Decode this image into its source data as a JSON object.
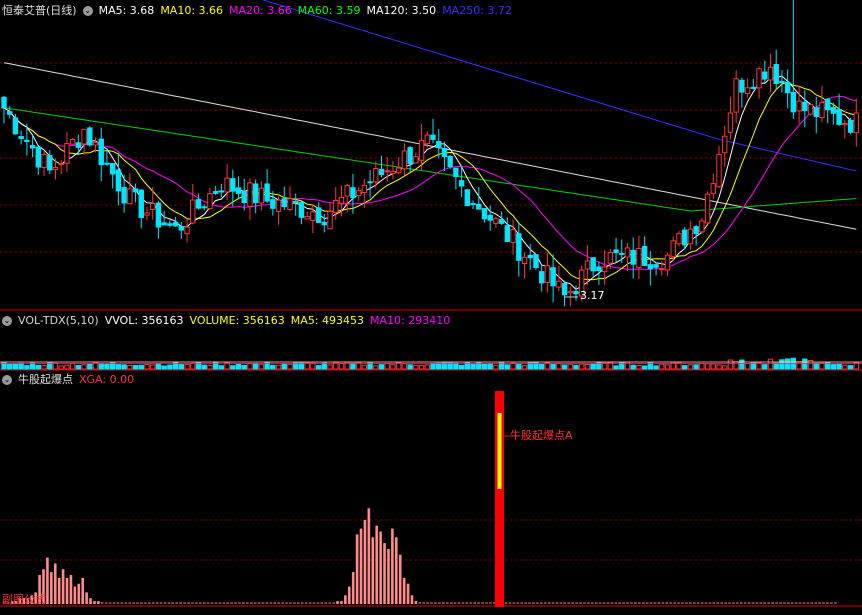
{
  "main_header": {
    "stock": "恒泰艾普",
    "period": "(日线)",
    "ma_items": [
      {
        "label": "MA5: 3.68",
        "color": "#ffffff"
      },
      {
        "label": "MA10: 3.66",
        "color": "#ffff00"
      },
      {
        "label": "MA20: 3.66",
        "color": "#ff00ff"
      },
      {
        "label": "MA60: 3.59",
        "color": "#00ff00"
      },
      {
        "label": "MA120: 3.50",
        "color": "#ffffff"
      },
      {
        "label": "MA250: 3.72",
        "color": "#3333ff"
      }
    ]
  },
  "low_marker": "3.17",
  "vol_header": {
    "items": [
      {
        "label": "VOL-TDX(5,10)",
        "color": "#d8d8d8"
      },
      {
        "label": "VVOL: 356163",
        "color": "#ffffff"
      },
      {
        "label": "VOLUME: 356163",
        "color": "#ffff00"
      },
      {
        "label": "MA5: 493453",
        "color": "#ffff00"
      },
      {
        "label": "MA10: 293410",
        "color": "#ff00ff"
      }
    ]
  },
  "ind_header": {
    "name": "牛股起爆点",
    "xga": "XGA: 0.00"
  },
  "signal_label": "牛股起爆点A",
  "corner_label": "副图公式",
  "colors": {
    "up": "#ff3333",
    "down": "#00e5ff",
    "grid": "#8b0000",
    "sep": "#b00000",
    "bar": "#ff8a8a",
    "signal": "#ff0000",
    "signal_core": "#ffff00"
  },
  "chart_data": [
    {
      "type": "candlestick",
      "title": "恒泰艾普 (日线)",
      "series": [
        {
          "name": "MA5",
          "values": [
            3.68
          ]
        },
        {
          "name": "MA10",
          "values": [
            3.66
          ]
        },
        {
          "name": "MA20",
          "values": [
            3.66
          ]
        },
        {
          "name": "MA60",
          "values": [
            3.59
          ]
        },
        {
          "name": "MA120",
          "values": [
            3.5
          ]
        },
        {
          "name": "MA250",
          "values": [
            3.72
          ]
        }
      ],
      "annotations": [
        {
          "label": "3.17",
          "value": 3.17
        }
      ]
    },
    {
      "type": "bar",
      "title": "VOL-TDX(5,10)",
      "series": [
        {
          "name": "VVOL",
          "values": [
            356163
          ]
        },
        {
          "name": "VOLUME",
          "values": [
            356163
          ]
        },
        {
          "name": "MA5",
          "values": [
            493453
          ]
        },
        {
          "name": "MA10",
          "values": [
            293410
          ]
        }
      ]
    },
    {
      "type": "bar",
      "title": "牛股起爆点",
      "series": [
        {
          "name": "XGA",
          "values": [
            0.0
          ]
        },
        {
          "name": "牛股起爆点",
          "values": [
            0,
            0,
            1,
            1,
            2,
            2,
            2,
            3,
            4,
            10,
            12,
            16,
            11,
            14,
            9,
            12,
            9,
            10,
            6,
            7,
            9,
            4,
            2,
            1,
            1,
            0,
            0,
            0,
            0,
            0,
            0,
            0,
            0,
            0,
            0,
            0,
            0,
            0,
            0,
            0,
            0,
            0,
            0,
            0,
            0,
            0,
            0,
            0,
            0,
            0,
            0,
            0,
            0,
            0,
            0,
            0,
            0,
            0,
            0,
            0,
            0,
            0,
            0,
            0,
            0,
            0,
            0,
            0,
            0,
            0,
            0,
            0,
            0,
            0,
            0,
            0,
            0,
            0,
            0,
            0,
            0,
            0,
            0,
            0,
            0,
            1,
            1,
            3,
            6,
            11,
            24,
            26,
            29,
            33,
            23,
            27,
            25,
            21,
            19,
            26,
            23,
            17,
            9,
            7,
            3,
            1,
            0,
            0,
            0,
            0,
            0,
            0,
            0,
            0,
            0,
            0,
            0,
            0,
            0,
            0,
            0,
            0,
            0,
            0,
            0,
            0,
            0,
            0,
            0,
            0,
            0,
            0,
            0,
            0,
            0,
            0,
            0,
            0,
            0,
            0,
            0,
            0,
            0,
            0,
            0,
            0,
            0,
            0,
            0,
            0,
            0,
            0,
            0,
            0,
            0,
            0,
            0,
            0,
            0,
            0,
            0,
            0,
            0,
            0,
            0,
            0,
            0,
            0,
            0,
            0,
            0,
            0,
            0,
            0,
            0,
            0,
            0,
            0,
            0,
            0,
            0,
            0,
            0,
            0,
            0,
            0,
            0,
            0,
            0,
            0,
            0,
            0,
            0,
            0,
            0,
            0,
            0,
            0,
            0,
            0,
            0,
            0,
            0,
            0,
            0,
            0,
            0,
            0,
            0,
            0,
            0,
            0,
            0
          ]
        },
        {
          "name": "牛股起爆点A",
          "values": [
            1
          ]
        }
      ]
    }
  ]
}
